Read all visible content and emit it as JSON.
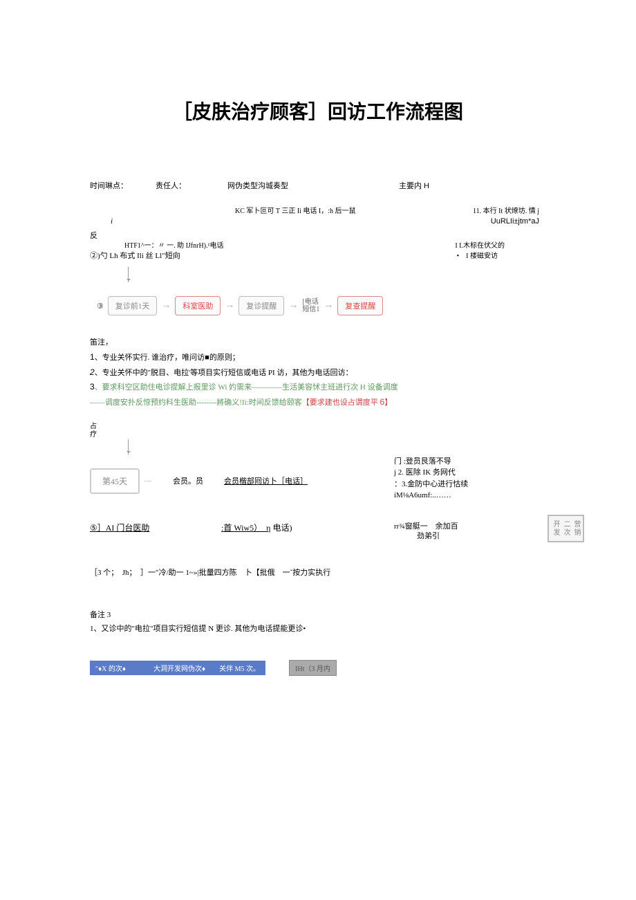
{
  "title": "［皮肤治疗顾客］回访工作流程图",
  "header": {
    "c1": "时间琳点：",
    "c2": "责任人：",
    "c3": "网伪类型沟城奏型",
    "c4": "主要内 H"
  },
  "block1": {
    "line_kc": "KC 军卜叵可 T 三正 Ii 电话 I，:h 后一鼠",
    "line_11": "11. 本行 It 状燎坊. 情 j",
    "i": "i",
    "uur": "UuRLIi±jtm*aJ",
    "fan": "反",
    "hf1": "HTF1^一：〃 一. 助 IJfnrH).¹电话",
    "ii": "I I.木标在伏父的",
    "line2": "②)勺 Lh 布式 Ili 丝 Ll″短向",
    "line2b": "•　I 楼磁安访"
  },
  "flow3": {
    "num": "③",
    "box1": "复诊前1天",
    "box2": "科室医助",
    "box3": "复诊提醒",
    "phone1": "[电话",
    "phone2": "短信1",
    "box4": "复查提醒"
  },
  "notes1": {
    "head": "笛注，",
    "l1": "1、专业关怀实行. 谁治疗，唯问访■的原则；",
    "l2": "2、专业关怀中的\"脱目、电拉'等项目实行短信或电话 PI 访，其他为电话回访：",
    "l3a": "3、要求科空区助住电诊提解上报里诊 Wi 妁需来————生活美容怵主班进行次 H 设备调度",
    "l3b": "——调度安扑反惊预约科生医助--------將确义!Ii:时间反馈给颐客【要求建也设占谓度平 6】"
  },
  "side_v": "占\n疗",
  "flow45": {
    "box": "第45天",
    "label1": "会员。员",
    "label2": "会员楷部囘访卜［电话］",
    "r1": "门 :登员艮落不导",
    "r2": "j 2. 医除 IK 务网代",
    "r3": "：3.金防中心进行怙续",
    "r4": "iM⅛A6umf:..……"
  },
  "row5": {
    "a": "⑤］AI 门台医助",
    "b_u": ":首 Wiw5）　η",
    "b_tail": " 电话)",
    "c1": "rr¾窗艇一　余加百",
    "c2": "劲弟引",
    "side": "营销二次开发"
  },
  "row3g": "［3 个；　Jh；　］一″冷/助一 1~»|批量四方陈　卜【批俄　一ˇ按力实执行",
  "notes3": {
    "head": "备注 3",
    "l1": "1、又诊中的\"电拉\"项目实行短信提 N 更诊. 其他为电话提能更诊•"
  },
  "bluebar": "\"♦X 的次♦　　　　大洞开发网伪次♦　　关伴 M5 次。",
  "graybox": "IHt（3 月内"
}
